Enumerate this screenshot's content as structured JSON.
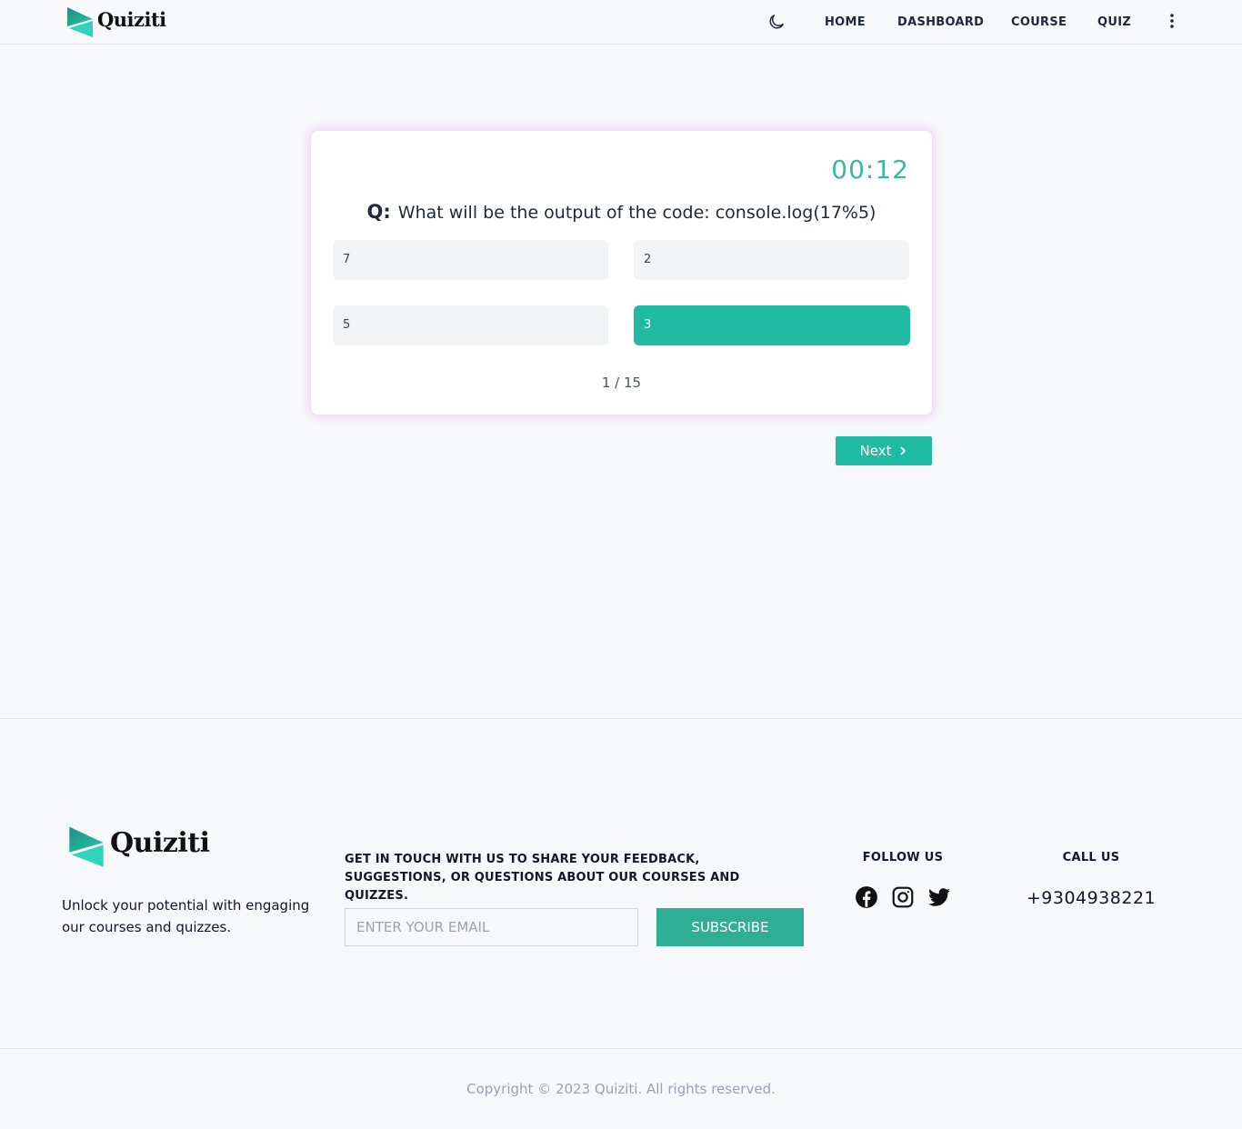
{
  "header": {
    "brand": "Quiziti",
    "nav": [
      "HOME",
      "DASHBOARD",
      "COURSE",
      "QUIZ"
    ],
    "theme_icon": "moon-icon",
    "menu_icon": "kebab-menu-icon"
  },
  "quiz": {
    "timer": "00:12",
    "question_prefix": "Q:",
    "question": "What will be the output of the code: console.log(17%5)",
    "options": [
      "7",
      "2",
      "5",
      "3"
    ],
    "selected_option": "3",
    "progress": "1 / 15",
    "next_label": "Next"
  },
  "footer": {
    "brand": "Quiziti",
    "tagline": "Unlock your potential with engaging our courses and quizzes.",
    "contact_text": "GET IN TOUCH WITH US TO SHARE YOUR FEEDBACK, SUGGESTIONS, OR QUESTIONS ABOUT OUR COURSES AND QUIZZES.",
    "email_placeholder": "ENTER YOUR EMAIL",
    "subscribe_label": "SUBSCRIBE",
    "follow_title": "FOLLOW US",
    "social_icons": [
      "facebook-icon",
      "instagram-icon",
      "twitter-icon"
    ],
    "call_title": "CALL US",
    "phone": "+9304938221",
    "copyright": "Copyright © 2023 Quiziti. All rights reserved."
  },
  "colors": {
    "accent": "#20bba2",
    "timer": "#3ab8a3",
    "background": "#f7f8fa"
  }
}
